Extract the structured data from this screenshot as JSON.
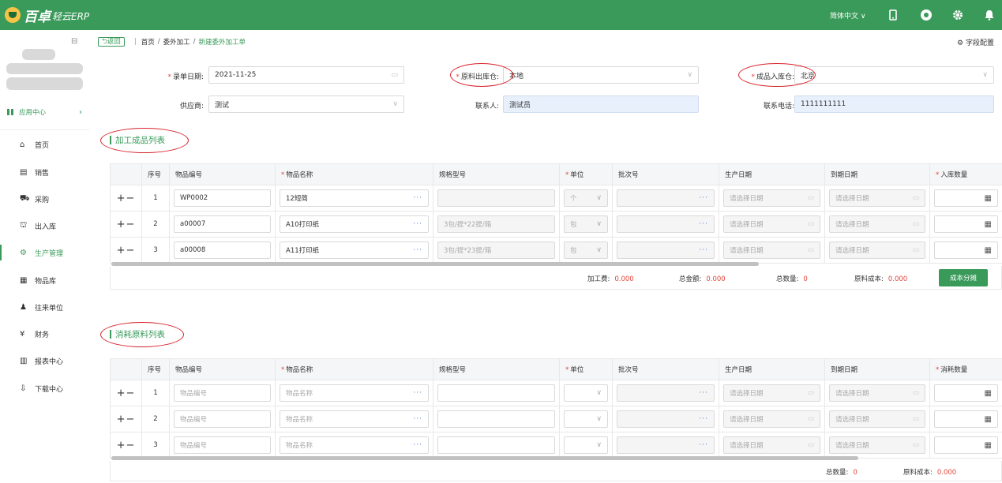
{
  "app": {
    "logo_main": "百卓",
    "logo_sub": "轻云ERP",
    "language": "简体中文 ∨"
  },
  "icons": [
    "phone-icon",
    "help-icon",
    "gear-icon",
    "bell-icon"
  ],
  "sidebar": {
    "collapse_glyph": "⊟",
    "app_center": "应用中心",
    "items": [
      {
        "label": "首页",
        "icon": "home-icon",
        "glyph": "⌂"
      },
      {
        "label": "销售",
        "icon": "sales-icon",
        "glyph": "▤"
      },
      {
        "label": "采购",
        "icon": "cart-icon",
        "glyph": "⛟"
      },
      {
        "label": "出入库",
        "icon": "warehouse-icon",
        "glyph": "⛫"
      },
      {
        "label": "生产管理",
        "icon": "production-icon",
        "glyph": "⚙"
      },
      {
        "label": "物品库",
        "icon": "items-icon",
        "glyph": "▦"
      },
      {
        "label": "往来单位",
        "icon": "partner-icon",
        "glyph": "♟"
      },
      {
        "label": "财务",
        "icon": "finance-icon",
        "glyph": "¥"
      },
      {
        "label": "报表中心",
        "icon": "report-icon",
        "glyph": "▥"
      },
      {
        "label": "下载中心",
        "icon": "download-icon",
        "glyph": "⇩"
      }
    ],
    "active_index": 4
  },
  "breadcrumb": {
    "back": "⮌返回",
    "items": [
      "首页",
      "委外加工",
      "新建委外加工单"
    ]
  },
  "field_config": "字段配置",
  "form": {
    "date_label": "录单日期:",
    "date_value": "2021-11-25",
    "out_wh_label": "原料出库仓:",
    "out_wh_value": "本地",
    "in_wh_label": "成品入库仓:",
    "in_wh_value": "北京",
    "supplier_label": "供应商:",
    "supplier_value": "测试",
    "contact_label": "联系人:",
    "contact_value": "测试员",
    "phone_label": "联系电话:",
    "phone_value": "1111111111"
  },
  "finished": {
    "title": "加工成品列表",
    "headers": [
      "序号",
      "物品编号",
      "物品名称",
      "规格型号",
      "单位",
      "批次号",
      "生产日期",
      "到期日期",
      "入库数量"
    ],
    "required": [
      false,
      false,
      true,
      false,
      true,
      false,
      false,
      false,
      true
    ],
    "date_placeholder": "请选择日期",
    "rows": [
      {
        "no": "1",
        "code": "WP0002",
        "name": "12短简",
        "spec": "",
        "unit": "个"
      },
      {
        "no": "2",
        "code": "a00007",
        "name": "A10打印纸",
        "spec": "3包/提*22提/箱",
        "unit": "包"
      },
      {
        "no": "3",
        "code": "a00008",
        "name": "A11打印纸",
        "spec": "3包/提*23提/箱",
        "unit": "包"
      }
    ],
    "summary": {
      "fee_label": "加工费:",
      "fee": "0.000",
      "amount_label": "总金额:",
      "amount": "0.000",
      "qty_label": "总数量:",
      "qty": "0",
      "cost_label": "原料成本:",
      "cost": "0.000",
      "button": "成本分摊"
    }
  },
  "consumed": {
    "title": "消耗原料列表",
    "headers": [
      "序号",
      "物品编号",
      "物品名称",
      "规格型号",
      "单位",
      "批次号",
      "生产日期",
      "到期日期",
      "消耗数量"
    ],
    "required": [
      false,
      false,
      true,
      false,
      true,
      false,
      false,
      false,
      true
    ],
    "code_placeholder": "物品编号",
    "name_placeholder": "物品名称",
    "date_placeholder": "请选择日期",
    "rows": [
      {
        "no": "1"
      },
      {
        "no": "2"
      },
      {
        "no": "3"
      }
    ],
    "summary": {
      "qty_label": "总数量:",
      "qty": "0",
      "cost_label": "原料成本:",
      "cost": "0.000"
    }
  },
  "colors": {
    "brand": "#3a9a5a",
    "required": "#e2453b",
    "annotation": "#d8232a"
  }
}
